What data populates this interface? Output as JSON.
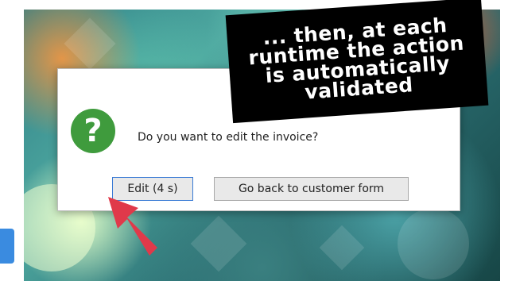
{
  "dialog": {
    "message": "Do you want to edit the invoice?",
    "icon": "question-icon",
    "icon_glyph": "?",
    "buttons": {
      "edit": "Edit (4 s)",
      "back": "Go back to customer form"
    }
  },
  "callout": {
    "text": "... then, at each runtime the action is automatically validated"
  },
  "colors": {
    "icon_green": "#3f9b3d",
    "callout_bg": "#000000",
    "arrow_red": "#e0394a",
    "side_tab": "#3a8be0"
  }
}
